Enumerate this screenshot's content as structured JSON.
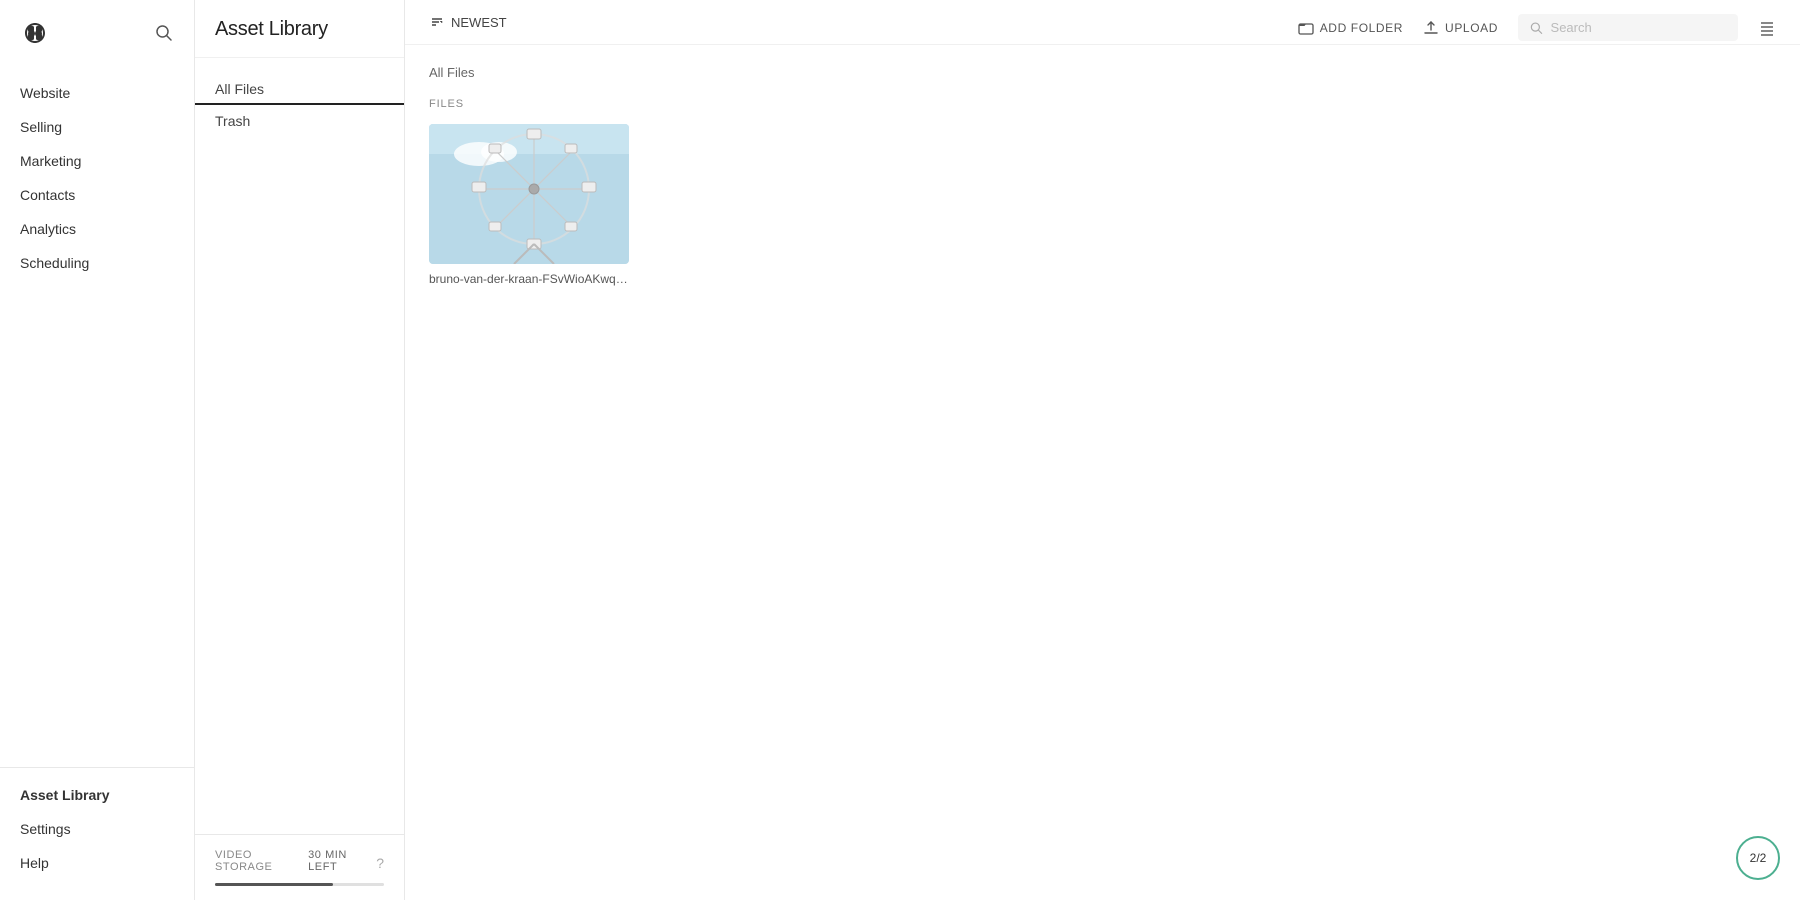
{
  "sidebar": {
    "logo": "squarespace-logo",
    "nav_items": [
      {
        "label": "Website",
        "id": "website"
      },
      {
        "label": "Selling",
        "id": "selling"
      },
      {
        "label": "Marketing",
        "id": "marketing"
      },
      {
        "label": "Contacts",
        "id": "contacts"
      },
      {
        "label": "Analytics",
        "id": "analytics"
      },
      {
        "label": "Scheduling",
        "id": "scheduling"
      }
    ],
    "bottom_items": [
      {
        "label": "Asset Library",
        "id": "asset-library",
        "active": true
      },
      {
        "label": "Settings",
        "id": "settings"
      },
      {
        "label": "Help",
        "id": "help"
      }
    ]
  },
  "folder_panel": {
    "title": "Asset Library",
    "nav_items": [
      {
        "label": "All Files",
        "id": "all-files",
        "active": true
      },
      {
        "label": "Trash",
        "id": "trash"
      }
    ],
    "footer": {
      "storage_label": "VIDEO STORAGE",
      "storage_time": "30 MIN LEFT",
      "bar_fill_percent": 70
    }
  },
  "toolbar": {
    "sort_label": "NEWEST",
    "add_folder_label": "ADD FOLDER",
    "upload_label": "UPLOAD",
    "search_placeholder": "Search"
  },
  "content": {
    "breadcrumb": "All Files",
    "section_label": "FILES",
    "files": [
      {
        "name": "bruno-van-der-kraan-FSvWioAKwqU-unsplas...",
        "short_name": "bruno-van-der-kraan-FSvWioAKwqU-unsplas..."
      }
    ]
  },
  "badge": {
    "label": "2/2"
  }
}
